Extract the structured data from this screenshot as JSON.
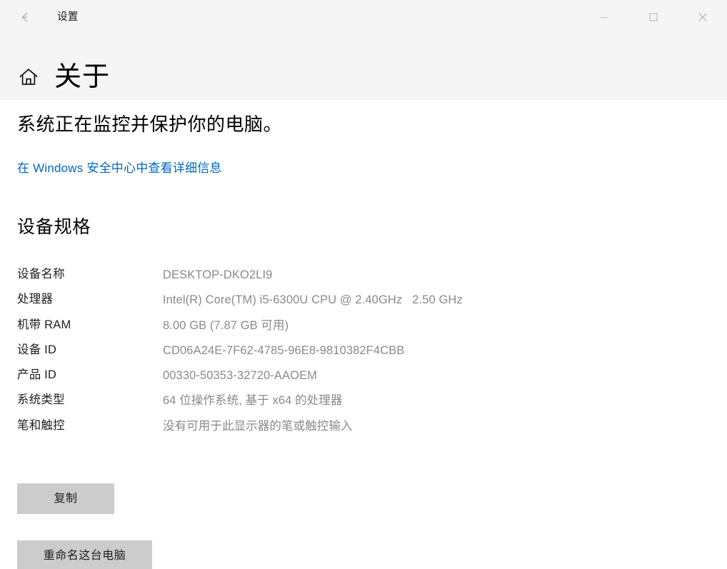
{
  "titlebar": {
    "back_icon": "back-arrow-icon",
    "title": "设置",
    "minimize_icon": "minimize-icon",
    "maximize_icon": "maximize-icon",
    "close_icon": "close-icon"
  },
  "header": {
    "home_icon": "home-icon",
    "title": "关于"
  },
  "security": {
    "status": "系统正在监控并保护你的电脑。",
    "link": "在 Windows 安全中心中查看详细信息",
    "link_color": "#0067c0"
  },
  "device_specs": {
    "heading": "设备规格",
    "rows": [
      {
        "label": "设备名称",
        "value": "DESKTOP-DKO2LI9"
      },
      {
        "label": "处理器",
        "value": "Intel(R) Core(TM) i5-6300U CPU @ 2.40GHz   2.50 GHz"
      },
      {
        "label": "机带 RAM",
        "value": "8.00 GB (7.87 GB 可用)"
      },
      {
        "label": "设备 ID",
        "value": "CD06A24E-7F62-4785-96E8-9810382F4CBB"
      },
      {
        "label": "产品 ID",
        "value": "00330-50353-32720-AAOEM"
      },
      {
        "label": "系统类型",
        "value": "64 位操作系统, 基于 x64 的处理器"
      },
      {
        "label": "笔和触控",
        "value": "没有可用于此显示器的笔或触控输入"
      }
    ]
  },
  "actions": {
    "copy_label": "复制",
    "rename_label": "重命名这台电脑"
  },
  "colors": {
    "titlebar_bg": "#f5f5f5",
    "content_bg": "#ffffff",
    "label_text": "#1f1f1f",
    "value_text": "#8a8a8a",
    "button_bg": "#cccccc"
  }
}
